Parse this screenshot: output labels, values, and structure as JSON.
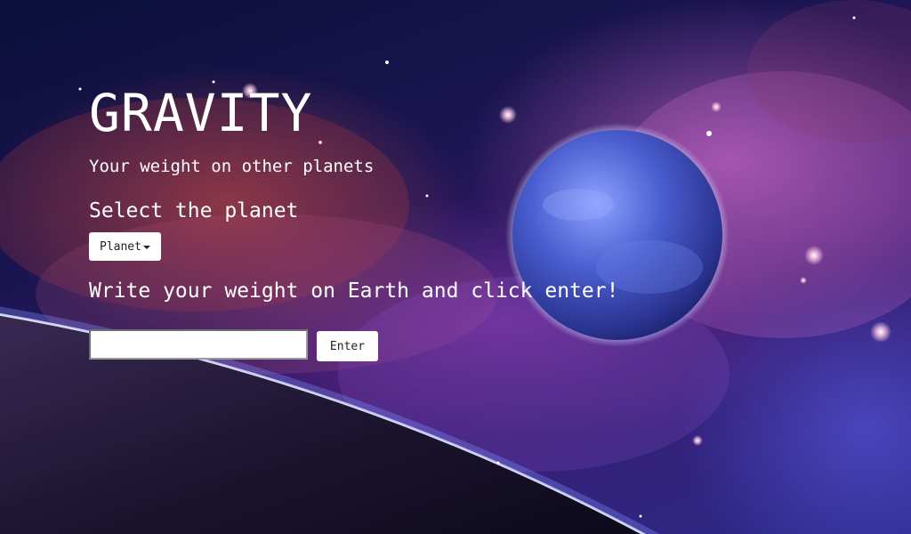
{
  "header": {
    "title": "GRAVITY",
    "subtitle": "Your weight on other planets"
  },
  "planet_select": {
    "label": "Select the planet",
    "dropdown_label": "Planet"
  },
  "weight_form": {
    "instruction": "Write your weight on Earth and click enter!",
    "input_value": "",
    "enter_label": "Enter"
  },
  "colors": {
    "text": "#ffffff",
    "button_bg": "#ffffff",
    "button_text": "#222222",
    "space_dark": "#0b0f3a",
    "nebula_pink": "#ec78dc",
    "nebula_red": "#d25046",
    "planet_blue": "#3f52c8"
  },
  "icons": {
    "dropdown": "caret-down-icon"
  }
}
